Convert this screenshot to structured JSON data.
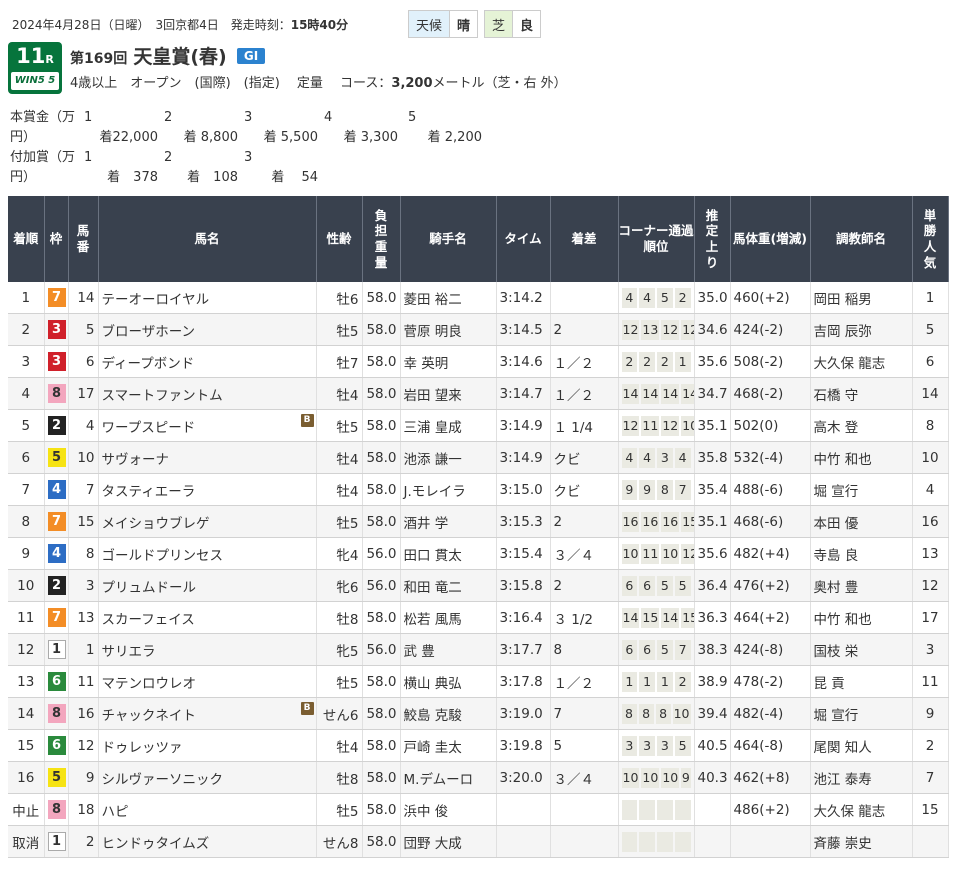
{
  "header": {
    "date_text": "2024年4月28日（日曜）　3回京都4日　発走時刻：",
    "start_time": "15時40分",
    "weather_label": "天候",
    "weather_value": "晴",
    "track_label": "芝",
    "track_value": "良"
  },
  "race": {
    "number": "11",
    "number_suffix": "R",
    "win5_label": "WIN5 5",
    "kai": "第169回",
    "name": "天皇賞(春)",
    "grade": "GI",
    "conditions_prefix": "4歳以上　オープン　(国際)　(指定)　 定量　 コース：",
    "distance": "3,200",
    "conditions_suffix": "メートル（芝・右 外）"
  },
  "prize": {
    "main_label": "本賞金（万円）",
    "main_ranks": [
      "1",
      "2",
      "3",
      "4",
      "5"
    ],
    "main_values": [
      "着22,000",
      "着 8,800",
      "着 5,500",
      "着 3,300",
      "着 2,200"
    ],
    "add_label": "付加賞（万円）",
    "add_ranks": [
      "1",
      "2",
      "3"
    ],
    "add_values": [
      "着　378",
      "着　108",
      "着　 54"
    ]
  },
  "table": {
    "headers": [
      "着順",
      "枠",
      "馬番",
      "馬名",
      "性齢",
      "負担重量",
      "騎手名",
      "タイム",
      "着差",
      "コーナー通過順位",
      "推定上り",
      "馬体重(増減)",
      "調教師名",
      "単勝人気"
    ],
    "rows": [
      {
        "rank": "1",
        "waku": "7",
        "num": "14",
        "name": "テーオーロイヤル",
        "blink": "",
        "sexage": "牡6",
        "wt": "58.0",
        "jockey": "菱田 裕二",
        "time": "3:14.2",
        "margin": "",
        "corner": [
          "4",
          "4",
          "5",
          "2"
        ],
        "agari": "35.0",
        "bw": "460(+2)",
        "trainer": "岡田 稲男",
        "pop": "1"
      },
      {
        "rank": "2",
        "waku": "3",
        "num": "5",
        "name": "ブローザホーン",
        "blink": "",
        "sexage": "牡5",
        "wt": "58.0",
        "jockey": "菅原 明良",
        "time": "3:14.5",
        "margin": "2",
        "corner": [
          "12",
          "13",
          "12",
          "12"
        ],
        "agari": "34.6",
        "bw": "424(-2)",
        "trainer": "吉岡 辰弥",
        "pop": "5"
      },
      {
        "rank": "3",
        "waku": "3",
        "num": "6",
        "name": "ディープボンド",
        "blink": "",
        "sexage": "牡7",
        "wt": "58.0",
        "jockey": "幸 英明",
        "time": "3:14.6",
        "margin": "１／２",
        "corner": [
          "2",
          "2",
          "2",
          "1"
        ],
        "agari": "35.6",
        "bw": "508(-2)",
        "trainer": "大久保 龍志",
        "pop": "6"
      },
      {
        "rank": "4",
        "waku": "8",
        "num": "17",
        "name": "スマートファントム",
        "blink": "",
        "sexage": "牡4",
        "wt": "58.0",
        "jockey": "岩田 望来",
        "time": "3:14.7",
        "margin": "１／２",
        "corner": [
          "14",
          "14",
          "14",
          "14"
        ],
        "agari": "34.7",
        "bw": "468(-2)",
        "trainer": "石橋 守",
        "pop": "14"
      },
      {
        "rank": "5",
        "waku": "2",
        "num": "4",
        "name": "ワープスピード",
        "blink": "B",
        "sexage": "牡5",
        "wt": "58.0",
        "jockey": "三浦 皇成",
        "time": "3:14.9",
        "margin": "１ 1/4",
        "corner": [
          "12",
          "11",
          "12",
          "10"
        ],
        "agari": "35.1",
        "bw": "502(0)",
        "trainer": "高木 登",
        "pop": "8"
      },
      {
        "rank": "6",
        "waku": "5",
        "num": "10",
        "name": "サヴォーナ",
        "blink": "",
        "sexage": "牡4",
        "wt": "58.0",
        "jockey": "池添 謙一",
        "time": "3:14.9",
        "margin": "クビ",
        "corner": [
          "4",
          "4",
          "3",
          "4"
        ],
        "agari": "35.8",
        "bw": "532(-4)",
        "trainer": "中竹 和也",
        "pop": "10"
      },
      {
        "rank": "7",
        "waku": "4",
        "num": "7",
        "name": "タスティエーラ",
        "blink": "",
        "sexage": "牡4",
        "wt": "58.0",
        "jockey": "J.モレイラ",
        "time": "3:15.0",
        "margin": "クビ",
        "corner": [
          "9",
          "9",
          "8",
          "7"
        ],
        "agari": "35.4",
        "bw": "488(-6)",
        "trainer": "堀 宣行",
        "pop": "4"
      },
      {
        "rank": "8",
        "waku": "7",
        "num": "15",
        "name": "メイショウブレゲ",
        "blink": "",
        "sexage": "牡5",
        "wt": "58.0",
        "jockey": "酒井 学",
        "time": "3:15.3",
        "margin": "2",
        "corner": [
          "16",
          "16",
          "16",
          "15"
        ],
        "agari": "35.1",
        "bw": "468(-6)",
        "trainer": "本田 優",
        "pop": "16"
      },
      {
        "rank": "9",
        "waku": "4",
        "num": "8",
        "name": "ゴールドプリンセス",
        "blink": "",
        "sexage": "牝4",
        "wt": "56.0",
        "jockey": "田口 貫太",
        "time": "3:15.4",
        "margin": "３／４",
        "corner": [
          "10",
          "11",
          "10",
          "12"
        ],
        "agari": "35.6",
        "bw": "482(+4)",
        "trainer": "寺島 良",
        "pop": "13"
      },
      {
        "rank": "10",
        "waku": "2",
        "num": "3",
        "name": "プリュムドール",
        "blink": "",
        "sexage": "牝6",
        "wt": "56.0",
        "jockey": "和田 竜二",
        "time": "3:15.8",
        "margin": "2",
        "corner": [
          "6",
          "6",
          "5",
          "5"
        ],
        "agari": "36.4",
        "bw": "476(+2)",
        "trainer": "奥村 豊",
        "pop": "12"
      },
      {
        "rank": "11",
        "waku": "7",
        "num": "13",
        "name": "スカーフェイス",
        "blink": "",
        "sexage": "牡8",
        "wt": "58.0",
        "jockey": "松若 風馬",
        "time": "3:16.4",
        "margin": "３ 1/2",
        "corner": [
          "14",
          "15",
          "14",
          "15"
        ],
        "agari": "36.3",
        "bw": "464(+2)",
        "trainer": "中竹 和也",
        "pop": "17"
      },
      {
        "rank": "12",
        "waku": "1",
        "num": "1",
        "name": "サリエラ",
        "blink": "",
        "sexage": "牝5",
        "wt": "56.0",
        "jockey": "武 豊",
        "time": "3:17.7",
        "margin": "8",
        "corner": [
          "6",
          "6",
          "5",
          "7"
        ],
        "agari": "38.3",
        "bw": "424(-8)",
        "trainer": "国枝 栄",
        "pop": "3"
      },
      {
        "rank": "13",
        "waku": "6",
        "num": "11",
        "name": "マテンロウレオ",
        "blink": "",
        "sexage": "牡5",
        "wt": "58.0",
        "jockey": "横山 典弘",
        "time": "3:17.8",
        "margin": "１／２",
        "corner": [
          "1",
          "1",
          "1",
          "2"
        ],
        "agari": "38.9",
        "bw": "478(-2)",
        "trainer": "昆 貢",
        "pop": "11"
      },
      {
        "rank": "14",
        "waku": "8",
        "num": "16",
        "name": "チャックネイト",
        "blink": "B",
        "sexage": "せん6",
        "wt": "58.0",
        "jockey": "鮫島 克駿",
        "time": "3:19.0",
        "margin": "7",
        "corner": [
          "8",
          "8",
          "8",
          "10"
        ],
        "agari": "39.4",
        "bw": "482(-4)",
        "trainer": "堀 宣行",
        "pop": "9"
      },
      {
        "rank": "15",
        "waku": "6",
        "num": "12",
        "name": "ドゥレッツァ",
        "blink": "",
        "sexage": "牡4",
        "wt": "58.0",
        "jockey": "戸崎 圭太",
        "time": "3:19.8",
        "margin": "5",
        "corner": [
          "3",
          "3",
          "3",
          "5"
        ],
        "agari": "40.5",
        "bw": "464(-8)",
        "trainer": "尾関 知人",
        "pop": "2"
      },
      {
        "rank": "16",
        "waku": "5",
        "num": "9",
        "name": "シルヴァーソニック",
        "blink": "",
        "sexage": "牡8",
        "wt": "58.0",
        "jockey": "M.デムーロ",
        "time": "3:20.0",
        "margin": "３／４",
        "corner": [
          "10",
          "10",
          "10",
          "9"
        ],
        "agari": "40.3",
        "bw": "462(+8)",
        "trainer": "池江 泰寿",
        "pop": "7"
      },
      {
        "rank": "中止",
        "waku": "8",
        "num": "18",
        "name": "ハピ",
        "blink": "",
        "sexage": "牡5",
        "wt": "58.0",
        "jockey": "浜中 俊",
        "time": "",
        "margin": "",
        "corner": [
          "",
          "",
          "",
          ""
        ],
        "agari": "",
        "bw": "486(+2)",
        "trainer": "大久保 龍志",
        "pop": "15"
      },
      {
        "rank": "取消",
        "waku": "1",
        "num": "2",
        "name": "ヒンドゥタイムズ",
        "blink": "",
        "sexage": "せん8",
        "wt": "58.0",
        "jockey": "団野 大成",
        "time": "",
        "margin": "",
        "corner": [
          "",
          "",
          "",
          ""
        ],
        "agari": "",
        "bw": "",
        "trainer": "斉藤 崇史",
        "pop": ""
      }
    ]
  }
}
